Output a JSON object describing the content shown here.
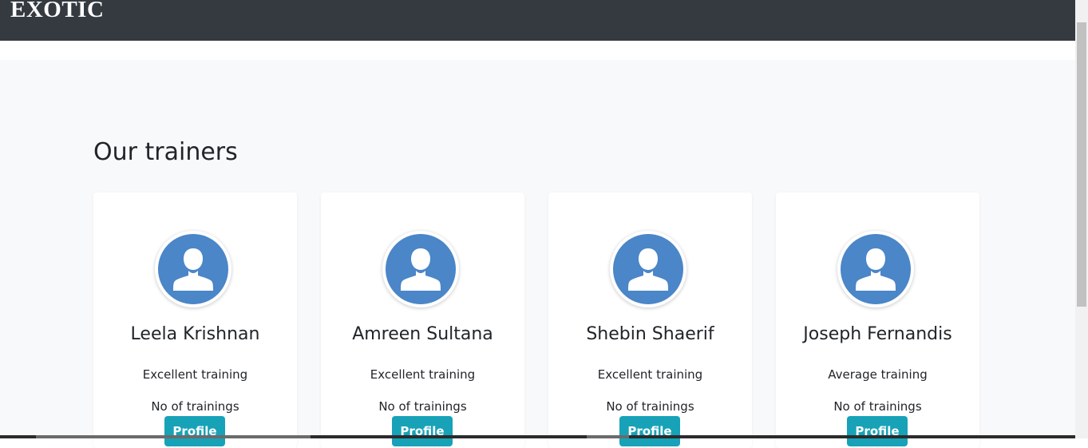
{
  "navbar": {
    "brand": "EXOTIC"
  },
  "section": {
    "title": "Our trainers"
  },
  "trainers": [
    {
      "name": "Leela Krishnan",
      "rating": "Excellent training",
      "trainings": "No of trainings",
      "button": "Profile",
      "avatar_icon": "user-silhouette-icon"
    },
    {
      "name": "Amreen Sultana",
      "rating": "Excellent training",
      "trainings": "No of trainings",
      "button": "Profile",
      "avatar_icon": "user-silhouette-icon"
    },
    {
      "name": "Shebin Shaerif",
      "rating": "Excellent training",
      "trainings": "No of trainings",
      "button": "Profile",
      "avatar_icon": "user-silhouette-icon"
    },
    {
      "name": "Joseph Fernandis",
      "rating": "Average training",
      "trainings": "No of trainings",
      "button": "Profile",
      "avatar_icon": "user-silhouette-icon"
    }
  ],
  "colors": {
    "navbar_bg": "#343a40",
    "section_bg": "#f8f9fa",
    "avatar_blue": "#4a86c8",
    "button_bg": "#17a2b8"
  }
}
